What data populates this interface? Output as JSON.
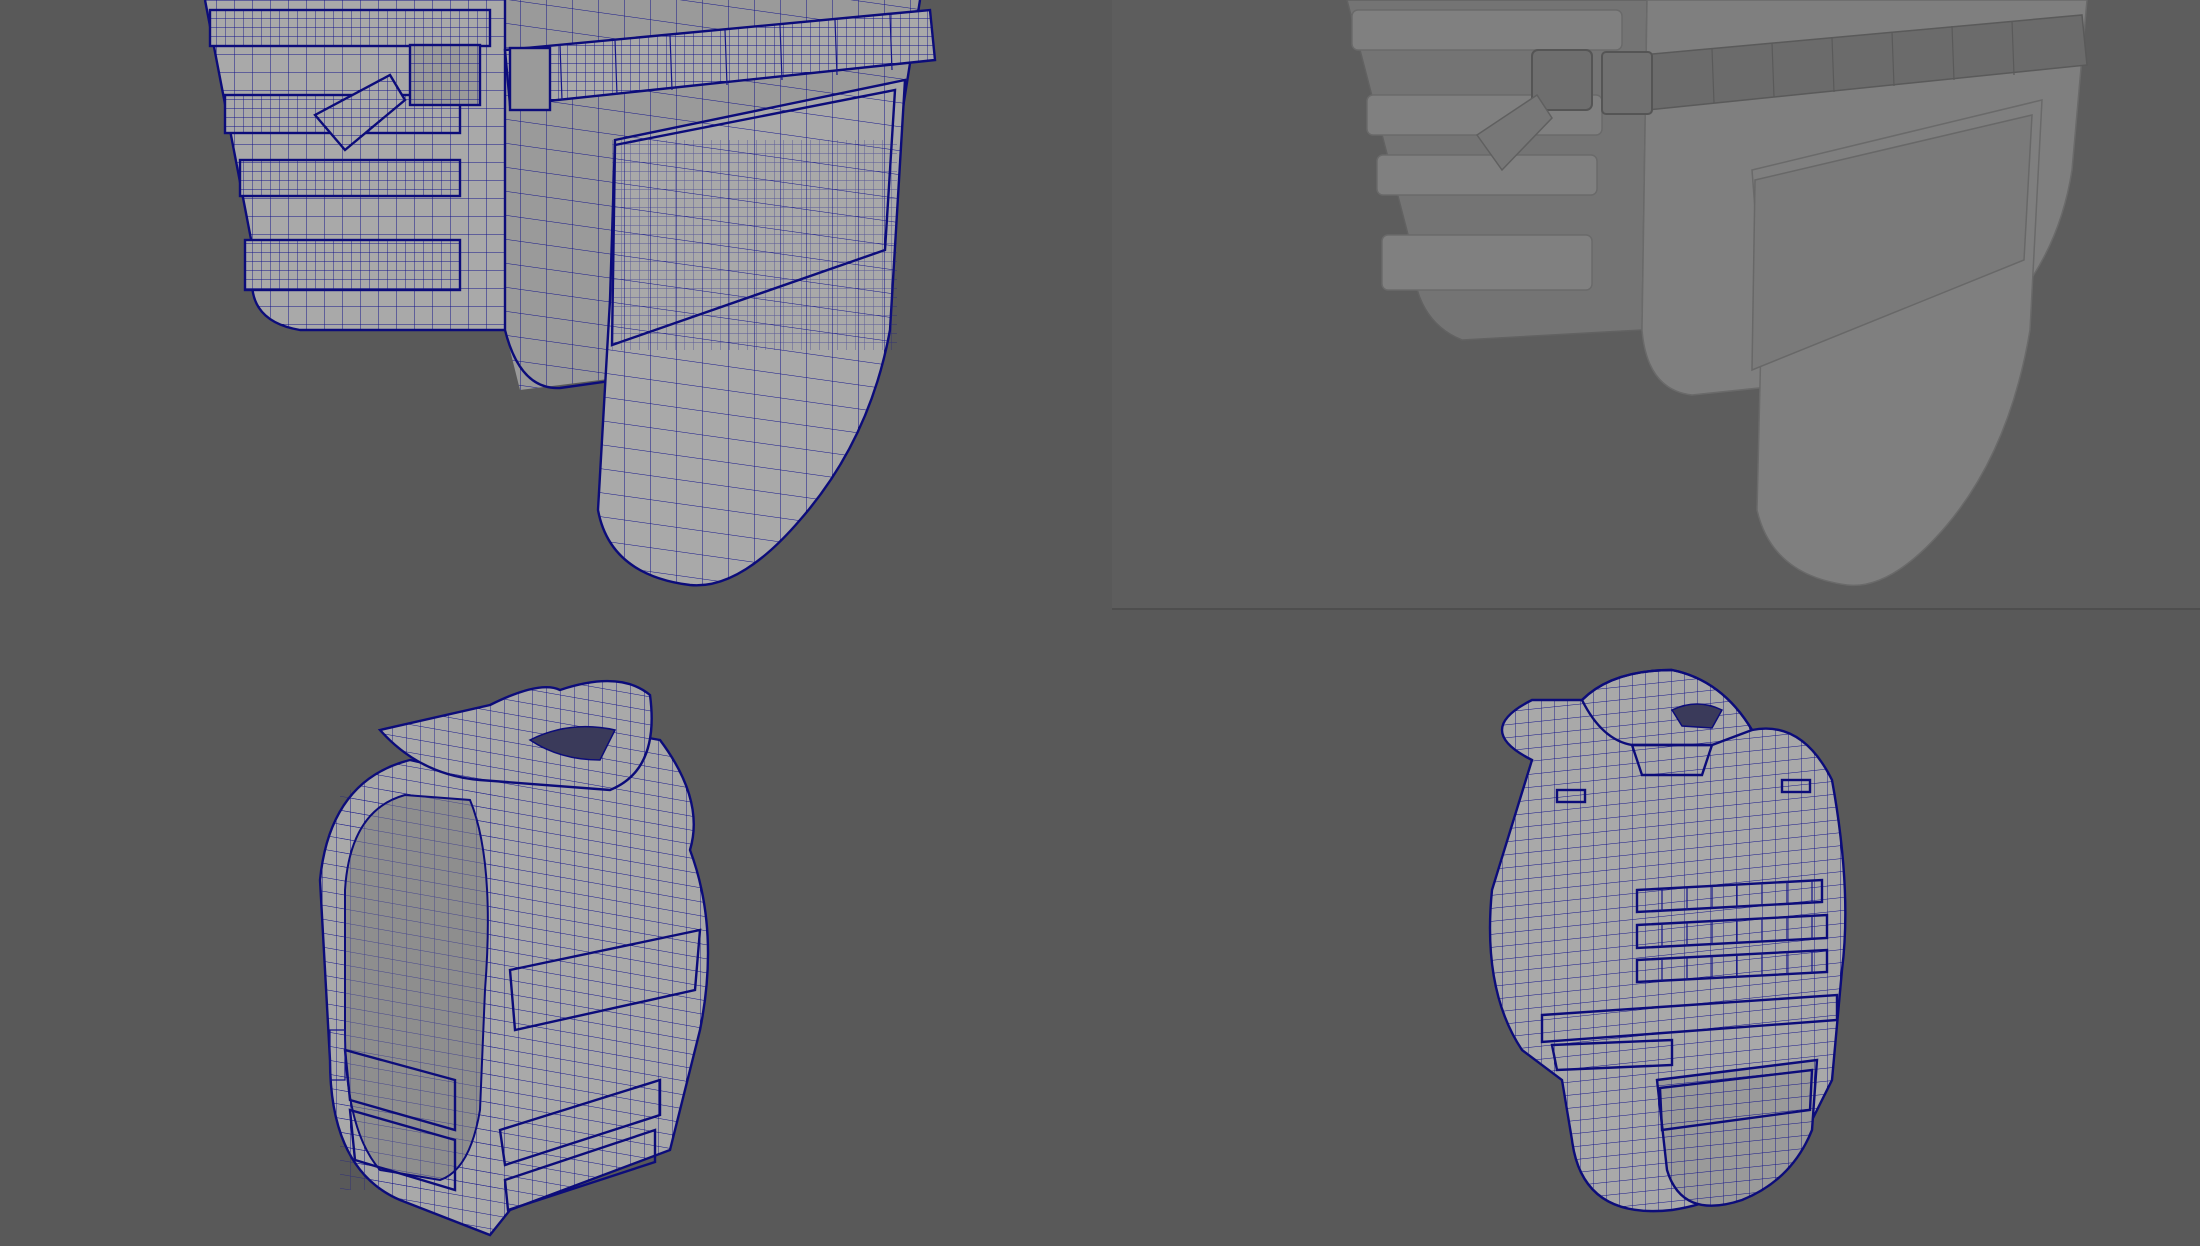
{
  "viewports": {
    "top_left": {
      "mode": "wireframe-on-shaded",
      "view": "closeup-belt-flap"
    },
    "top_right": {
      "mode": "smooth-shaded",
      "view": "closeup-belt-flap"
    },
    "bottom_left": {
      "mode": "wireframe-on-shaded",
      "view": "three-quarter-back"
    },
    "bottom_right": {
      "mode": "wireframe-on-shaded",
      "view": "three-quarter-front"
    }
  },
  "colors": {
    "background": "#595959",
    "shaded_background": "#5d5d5d",
    "wireframe": "#15158a",
    "surface": "#a9a9a9"
  },
  "icons": {
    "top_left": "vest-wireframe-closeup-icon",
    "top_right": "vest-shaded-closeup-icon",
    "bottom_left": "vest-wireframe-back-icon",
    "bottom_right": "vest-wireframe-front-icon"
  }
}
